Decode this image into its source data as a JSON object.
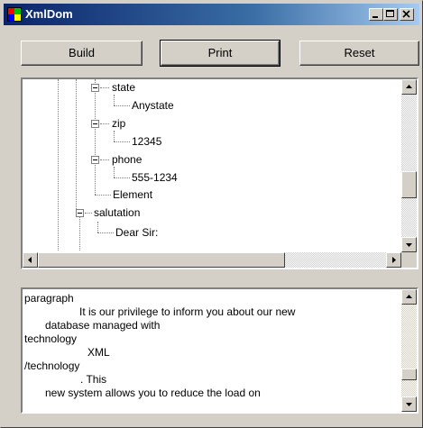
{
  "window": {
    "title": "XmlDom"
  },
  "toolbar": {
    "build_label": "Build",
    "print_label": "Print",
    "reset_label": "Reset"
  },
  "tree": {
    "nodes": [
      {
        "label": "state",
        "expander": true
      },
      {
        "label": "Anystate",
        "expander": false
      },
      {
        "label": "zip",
        "expander": true
      },
      {
        "label": "12345",
        "expander": false
      },
      {
        "label": "phone",
        "expander": true
      },
      {
        "label": "555-1234",
        "expander": false
      },
      {
        "label": "Element",
        "expander": false
      },
      {
        "label": "salutation",
        "expander": true
      },
      {
        "label": "Dear Sir:",
        "expander": false
      }
    ]
  },
  "output": {
    "lines": [
      "paragraph",
      "It is our privilege to inform you about our new",
      "database managed with",
      "technology",
      "XML",
      "/technology",
      ". This",
      "new system allows you to reduce the load on"
    ]
  },
  "icons": {
    "app": "xmldom-app-icon",
    "minimize": "minimize-icon",
    "maximize": "maximize-icon",
    "close": "close-icon"
  },
  "colors": {
    "title_bar": "#0a246a",
    "face": "#d4d0c8"
  }
}
